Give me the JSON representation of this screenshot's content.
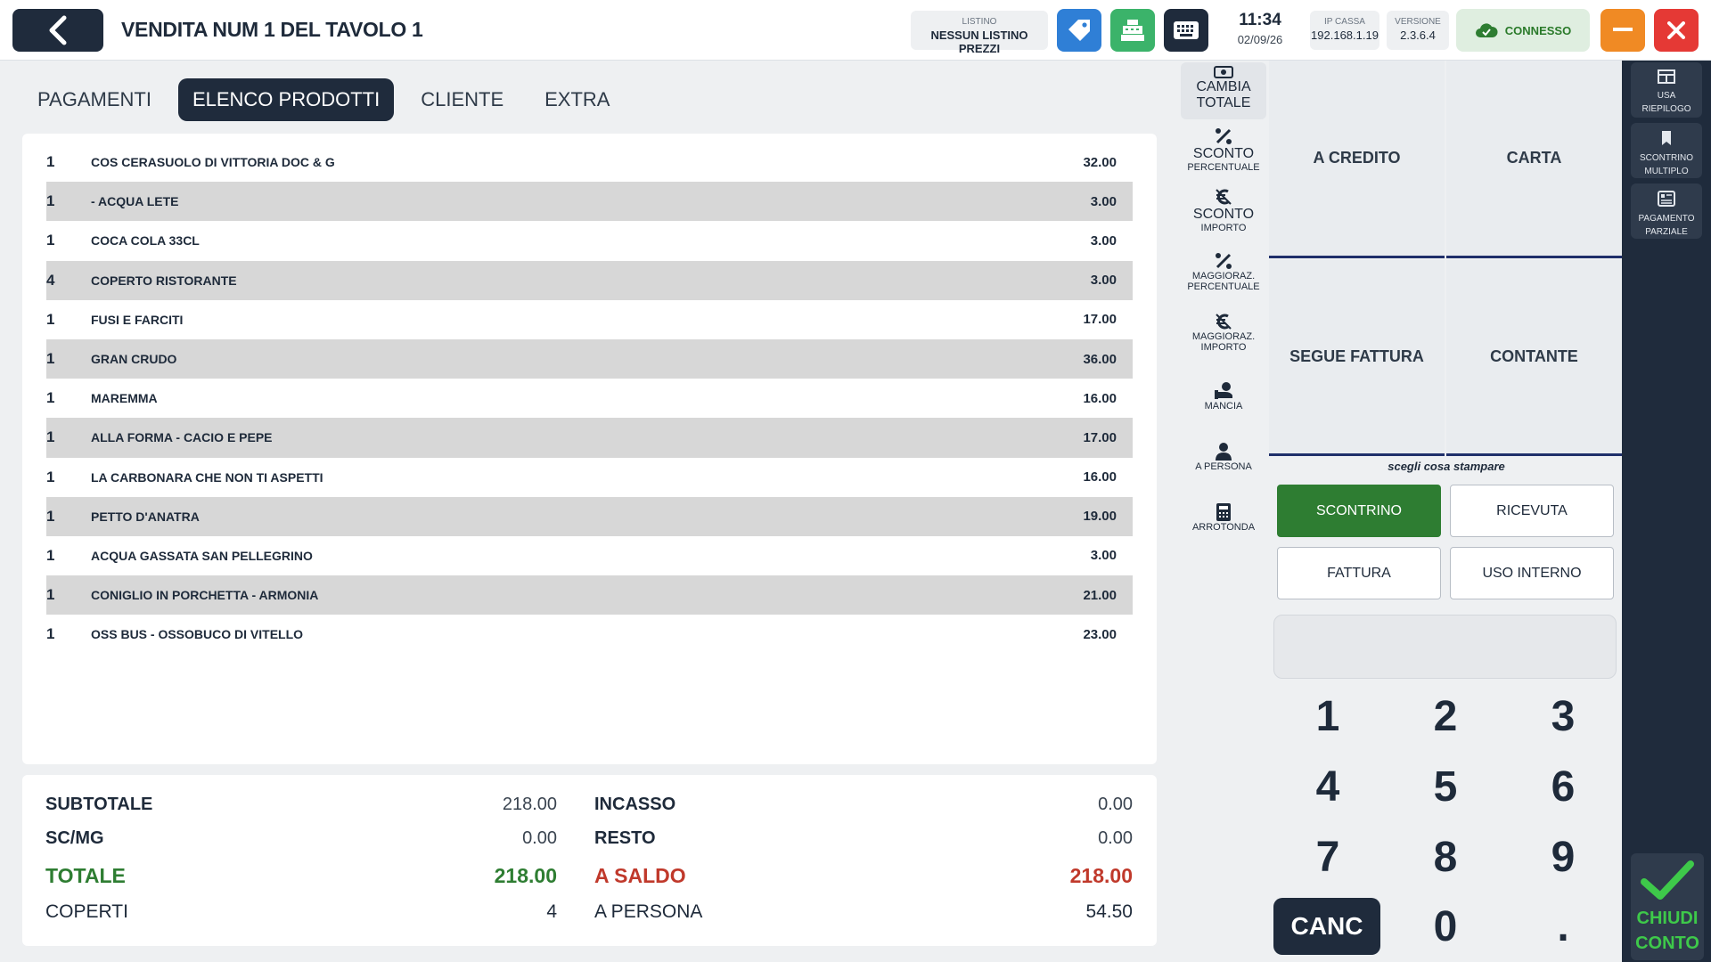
{
  "header": {
    "title": "VENDITA NUM 1 DEL TAVOLO 1",
    "listino_label": "LISTINO",
    "listino_value": "NESSUN LISTINO PREZZI",
    "time": "11:34",
    "date": "02/09/26",
    "ip_label": "IP CASSA",
    "ip_value": "192.168.1.19",
    "version_label": "VERSIONE",
    "version_value": "2.3.6.4",
    "status": "CONNESSO"
  },
  "tabs": [
    {
      "label": "PAGAMENTI"
    },
    {
      "label": "ELENCO PRODOTTI"
    },
    {
      "label": "CLIENTE"
    },
    {
      "label": "EXTRA"
    }
  ],
  "products": [
    {
      "qty": "1",
      "name": "COS CERASUOLO DI VITTORIA DOC & G",
      "price": "32.00"
    },
    {
      "qty": "1",
      "name": "- ACQUA LETE",
      "price": "3.00"
    },
    {
      "qty": "1",
      "name": "COCA COLA 33CL",
      "price": "3.00"
    },
    {
      "qty": "4",
      "name": "COPERTO RISTORANTE",
      "price": "3.00"
    },
    {
      "qty": "1",
      "name": "FUSI E FARCITI",
      "price": "17.00"
    },
    {
      "qty": "1",
      "name": "GRAN CRUDO",
      "price": "36.00"
    },
    {
      "qty": "1",
      "name": "MAREMMA",
      "price": "16.00"
    },
    {
      "qty": "1",
      "name": "ALLA FORMA -  CACIO E PEPE",
      "price": "17.00"
    },
    {
      "qty": "1",
      "name": "LA CARBONARA CHE NON TI ASPETTI",
      "price": "16.00"
    },
    {
      "qty": "1",
      "name": "PETTO D'ANATRA",
      "price": "19.00"
    },
    {
      "qty": "1",
      "name": "ACQUA GASSATA SAN PELLEGRINO",
      "price": "3.00"
    },
    {
      "qty": "1",
      "name": "CONIGLIO IN PORCHETTA - ARMONIA",
      "price": "21.00"
    },
    {
      "qty": "1",
      "name": "OSS BUS - OSSOBUCO DI VITELLO",
      "price": "23.00"
    }
  ],
  "totals": {
    "subtotale_label": "SUBTOTALE",
    "subtotale": "218.00",
    "scmg_label": "SC/MG",
    "scmg": "0.00",
    "totale_label": "TOTALE",
    "totale": "218.00",
    "coperti_label": "COPERTI",
    "coperti": "4",
    "incasso_label": "INCASSO",
    "incasso": "0.00",
    "resto_label": "RESTO",
    "resto": "0.00",
    "saldo_label": "A SALDO",
    "saldo": "218.00",
    "persona_label": "A PERSONA",
    "persona": "54.50"
  },
  "actions": {
    "cambia_l1": "CAMBIA",
    "cambia_l2": "TOTALE",
    "sconto_perc_l1": "SCONTO",
    "sconto_perc_l2": "PERCENTUALE",
    "sconto_imp_l1": "SCONTO",
    "sconto_imp_l2": "IMPORTO",
    "magg_perc_l1": "MAGGIORAZ.",
    "magg_perc_l2": "PERCENTUALE",
    "magg_imp_l1": "MAGGIORAZ.",
    "magg_imp_l2": "IMPORTO",
    "mancia": "MANCIA",
    "a_persona": "A PERSONA",
    "arrotonda": "ARROTONDA"
  },
  "payments": {
    "credito": "A CREDITO",
    "carta": "CARTA",
    "fattura": "SEGUE FATTURA",
    "contante": "CONTANTE"
  },
  "print": {
    "caption": "scegli cosa stampare",
    "scontrino": "SCONTRINO",
    "ricevuta": "RICEVUTA",
    "fattura": "FATTURA",
    "uso_interno": "USO INTERNO"
  },
  "keypad": {
    "k1": "1",
    "k2": "2",
    "k3": "3",
    "k4": "4",
    "k5": "5",
    "k6": "6",
    "k7": "7",
    "k8": "8",
    "k9": "9",
    "canc": "CANC",
    "k0": "0",
    "dot": "."
  },
  "sidebar": {
    "riepilogo_l1": "USA",
    "riepilogo_l2": "RIEPILOGO",
    "multiplo_l1": "SCONTRINO",
    "multiplo_l2": "MULTIPLO",
    "parziale_l1": "PAGAMENTO",
    "parziale_l2": "PARZIALE",
    "chiudi_l1": "CHIUDI",
    "chiudi_l2": "CONTO"
  },
  "colors": {
    "dark": "#1f2b3c",
    "tag_blue": "#2f7fd6",
    "register_green": "#3bb36a",
    "minimize_orange": "#f08a24",
    "close_red": "#e53935",
    "totale_green": "#2e7d32",
    "saldo_red": "#c0392b",
    "scontrino_green": "#2e7d32",
    "check_green": "#3ec94a"
  }
}
